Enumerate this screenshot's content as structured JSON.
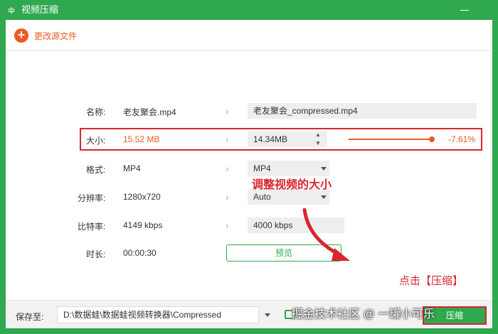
{
  "titlebar": {
    "title": "视频压缩",
    "app_icon": "equals-icon"
  },
  "toolbar": {
    "change_source_label": "更改源文件"
  },
  "rows": {
    "name": {
      "label": "名称:",
      "value": "老友聚会.mp4",
      "output": "老友聚会_compressed.mp4"
    },
    "size": {
      "label": "大小:",
      "value": "15.52 MB",
      "output": "14.34MB",
      "percent": "-7.61%",
      "slider_level": 0.93
    },
    "format": {
      "label": "格式:",
      "value": "MP4",
      "output": "MP4"
    },
    "resolution": {
      "label": "分辨率:",
      "value": "1280x720",
      "output": "Auto"
    },
    "bitrate": {
      "label": "比特率:",
      "value": "4149 kbps",
      "output": "4000 kbps"
    },
    "duration": {
      "label": "时长:",
      "value": "00:00:30"
    }
  },
  "preview_label": "预览",
  "annotations": {
    "size_hint": "调整视频的大小",
    "compress_hint": "点击【压缩】"
  },
  "footer": {
    "save_label": "保存至:",
    "path": "D:\\数据蛙\\数据蛙视频转换器\\Compressed",
    "compress_label": "压缩"
  },
  "watermark": "掘金技术社区 @ 一罐小可乐",
  "colors": {
    "accent": "#2fa84f",
    "highlight": "#ee5a24",
    "annotation": "#d9262e"
  }
}
